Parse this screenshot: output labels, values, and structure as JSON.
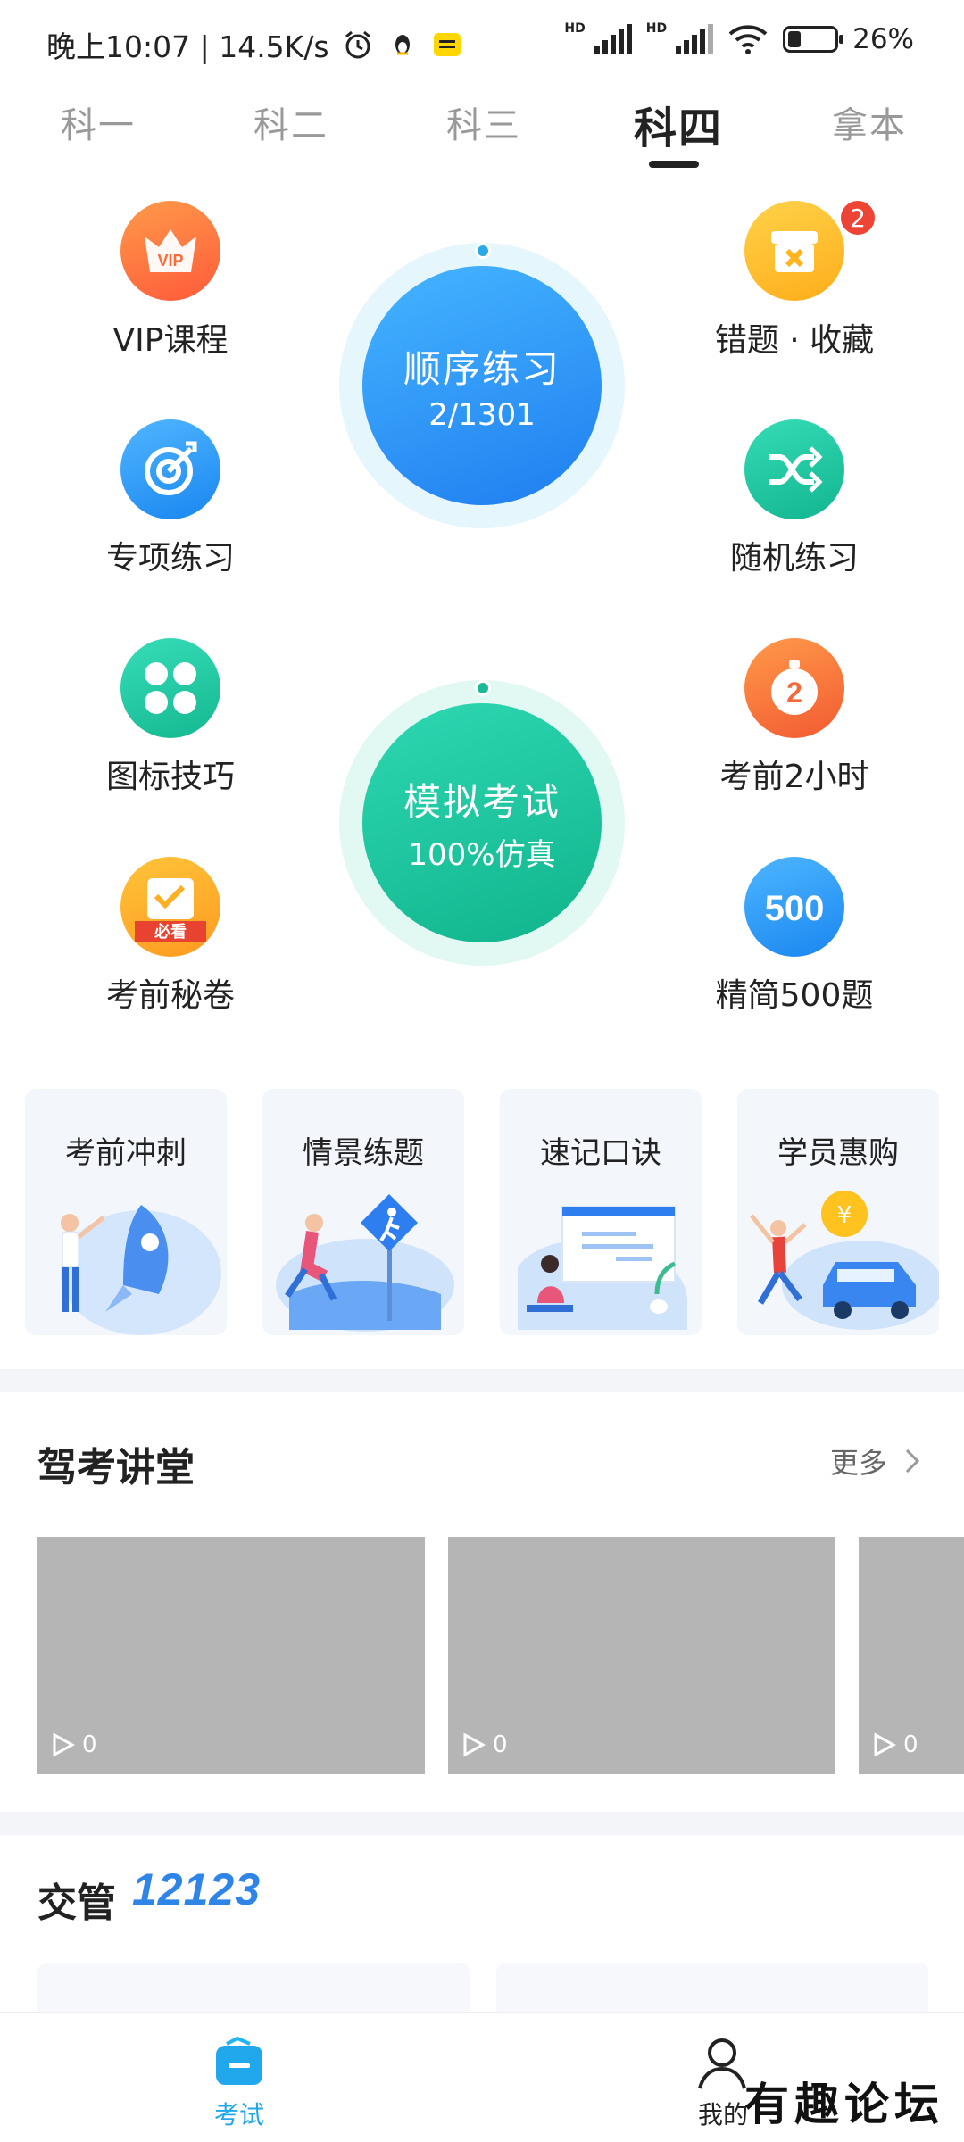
{
  "status": {
    "time": "晚上10:07 | 14.5K/s",
    "battery": "26%",
    "hd1": "HD",
    "hd2": "HD"
  },
  "tabs": [
    "科一",
    "科二",
    "科三",
    "科四",
    "拿本"
  ],
  "features": {
    "vip": "VIP课程",
    "vip_icon_text": "VIP",
    "wrong": "错题 · 收藏",
    "wrong_badge": "2",
    "special": "专项练习",
    "random": "随机练习",
    "icons": "图标技巧",
    "two_hours": "考前2小时",
    "two_hours_icon": "2",
    "secret": "考前秘卷",
    "secret_icon_text": "必看",
    "jing500": "精简500题",
    "jing500_icon": "500"
  },
  "order_practice": {
    "title": "顺序练习",
    "progress": "2/1301"
  },
  "mock_exam": {
    "title": "模拟考试",
    "sub": "100%仿真"
  },
  "cards": [
    "考前冲刺",
    "情景练题",
    "速记口诀",
    "学员惠购"
  ],
  "lecture": {
    "title": "驾考讲堂",
    "more": "更多",
    "views": [
      "0",
      "0",
      "0"
    ]
  },
  "traffic": {
    "title": "交管",
    "number": "12123"
  },
  "bottom": {
    "exam": "考试",
    "mine": "我的"
  },
  "watermark": "有趣论坛",
  "colors": {
    "blue": "#2a8ff0",
    "green": "#1fc6a3",
    "orange": "#ff8a3c",
    "active_tab": "#21a8ec"
  }
}
